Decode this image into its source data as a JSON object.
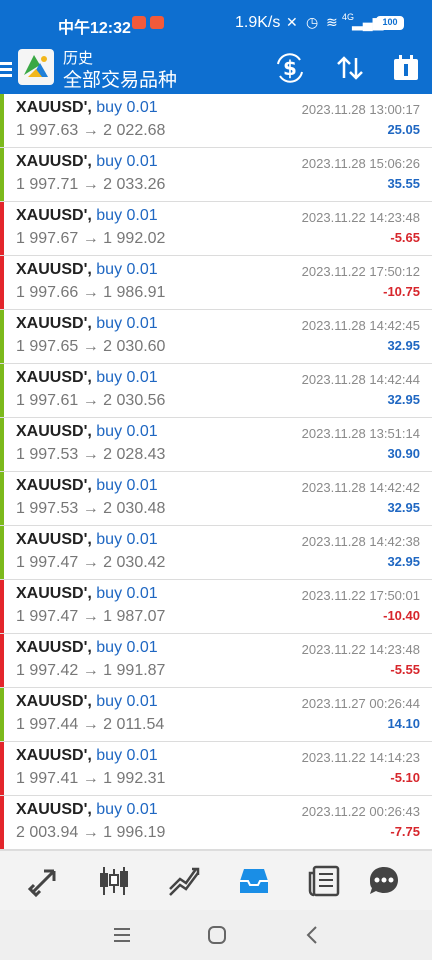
{
  "status_bar": {
    "time": "中午12:32",
    "net_speed": "1.9K/s",
    "signal": "4G",
    "battery": "100"
  },
  "toolbar": {
    "title": "历史",
    "subtitle": "全部交易品种"
  },
  "colors": {
    "primary": "#0e6fd0",
    "buy_bar": "#7cba1c",
    "loss_bar": "#e3262c",
    "profit_text": "#1f67c2",
    "loss_text": "#d7262c",
    "nav_active": "#1a8ee6"
  },
  "trades": [
    {
      "symbol": "XAUUSD',",
      "side": "buy 0.01",
      "prices": "1 997.63 → 2 022.68",
      "time": "2023.11.28 13:00:17",
      "profit": "25.05",
      "positive": true
    },
    {
      "symbol": "XAUUSD',",
      "side": "buy 0.01",
      "prices": "1 997.71 → 2 033.26",
      "time": "2023.11.28 15:06:26",
      "profit": "35.55",
      "positive": true
    },
    {
      "symbol": "XAUUSD',",
      "side": "buy 0.01",
      "prices": "1 997.67 → 1 992.02",
      "time": "2023.11.22 14:23:48",
      "profit": "-5.65",
      "positive": false
    },
    {
      "symbol": "XAUUSD',",
      "side": "buy 0.01",
      "prices": "1 997.66 → 1 986.91",
      "time": "2023.11.22 17:50:12",
      "profit": "-10.75",
      "positive": false
    },
    {
      "symbol": "XAUUSD',",
      "side": "buy 0.01",
      "prices": "1 997.65 → 2 030.60",
      "time": "2023.11.28 14:42:45",
      "profit": "32.95",
      "positive": true
    },
    {
      "symbol": "XAUUSD',",
      "side": "buy 0.01",
      "prices": "1 997.61 → 2 030.56",
      "time": "2023.11.28 14:42:44",
      "profit": "32.95",
      "positive": true
    },
    {
      "symbol": "XAUUSD',",
      "side": "buy 0.01",
      "prices": "1 997.53 → 2 028.43",
      "time": "2023.11.28 13:51:14",
      "profit": "30.90",
      "positive": true
    },
    {
      "symbol": "XAUUSD',",
      "side": "buy 0.01",
      "prices": "1 997.53 → 2 030.48",
      "time": "2023.11.28 14:42:42",
      "profit": "32.95",
      "positive": true
    },
    {
      "symbol": "XAUUSD',",
      "side": "buy 0.01",
      "prices": "1 997.47 → 2 030.42",
      "time": "2023.11.28 14:42:38",
      "profit": "32.95",
      "positive": true
    },
    {
      "symbol": "XAUUSD',",
      "side": "buy 0.01",
      "prices": "1 997.47 → 1 987.07",
      "time": "2023.11.22 17:50:01",
      "profit": "-10.40",
      "positive": false
    },
    {
      "symbol": "XAUUSD',",
      "side": "buy 0.01",
      "prices": "1 997.42 → 1 991.87",
      "time": "2023.11.22 14:23:48",
      "profit": "-5.55",
      "positive": false
    },
    {
      "symbol": "XAUUSD',",
      "side": "buy 0.01",
      "prices": "1 997.44 → 2 011.54",
      "time": "2023.11.27 00:26:44",
      "profit": "14.10",
      "positive": true
    },
    {
      "symbol": "XAUUSD',",
      "side": "buy 0.01",
      "prices": "1 997.41 → 1 992.31",
      "time": "2023.11.22 14:14:23",
      "profit": "-5.10",
      "positive": false
    },
    {
      "symbol": "XAUUSD',",
      "side": "buy 0.01",
      "prices": "2 003.94 → 1 996.19",
      "time": "2023.11.22 00:26:43",
      "profit": "-7.75",
      "positive": false
    }
  ],
  "bottom_nav": {
    "items": [
      {
        "icon": "quotes-icon",
        "active": false
      },
      {
        "icon": "chart-candles-icon",
        "active": false
      },
      {
        "icon": "trade-icon",
        "active": false
      },
      {
        "icon": "history-inbox-icon",
        "active": true
      },
      {
        "icon": "news-icon",
        "active": false
      },
      {
        "icon": "chat-icon",
        "active": false
      }
    ]
  }
}
